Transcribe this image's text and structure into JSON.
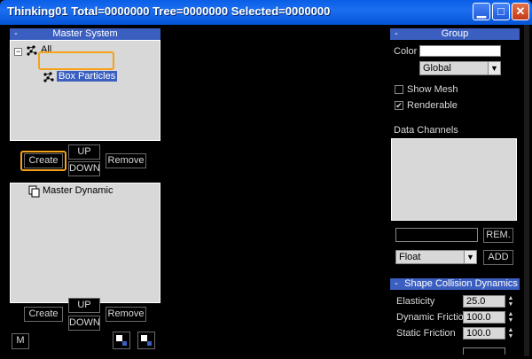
{
  "window": {
    "title": "Thinking01  Total=0000000  Tree=0000000  Selected=0000000",
    "min_glyph": "▁",
    "max_glyph": "□",
    "close_glyph": "✕"
  },
  "master_system": {
    "header": "Master System",
    "collapse": "-",
    "tree": [
      {
        "label": "All",
        "expander": "−"
      },
      {
        "label": "Box Particles"
      }
    ],
    "create_label": "Create",
    "up_label": "UP",
    "down_label": "DOWN",
    "remove_label": "Remove"
  },
  "dynamics": {
    "tree": [
      {
        "label": "Master Dynamic"
      }
    ],
    "create_label": "Create",
    "up_label": "UP",
    "down_label": "DOWN",
    "remove_label": "Remove",
    "m_label": "M"
  },
  "group": {
    "header": "Group",
    "collapse": "-",
    "color_label": "Color",
    "color_value": "#ffffff",
    "scope_dropdown": "Global",
    "show_mesh_label": "Show Mesh",
    "show_mesh_checked": false,
    "renderable_label": "Renderable",
    "renderable_checked": true,
    "renderable_glyph": "✔",
    "data_channels_label": "Data Channels",
    "rem_label": "REM.",
    "type_dropdown": "Float",
    "add_label": "ADD"
  },
  "shape_collision": {
    "header": "Shape Collision Dynamics",
    "collapse": "-",
    "fields": [
      {
        "label": "Elasticity",
        "value": "25.0"
      },
      {
        "label": "Dynamic Friction",
        "value": "100.0"
      },
      {
        "label": "Static Friction",
        "value": "100.0"
      }
    ],
    "spin_glyph": "▲▼"
  },
  "colors": {
    "accent": "#3b5fc0",
    "highlight": "#f5a11a",
    "panel": "#d8d8d8"
  }
}
